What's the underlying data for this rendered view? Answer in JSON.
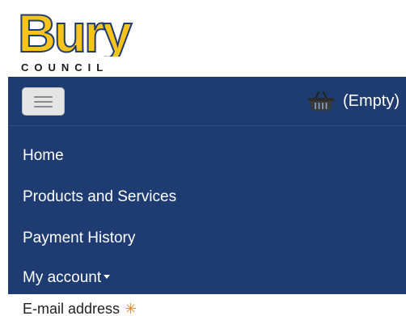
{
  "header": {
    "logo": {
      "brand_text": "Bury",
      "sub_text": "COUNCIL",
      "brand_color": "#f9c41a",
      "outline_color": "#1f3c72"
    }
  },
  "navbar": {
    "background": "#1f3c72",
    "menu_toggle_icon": "hamburger-icon",
    "basket": {
      "icon": "basket-icon",
      "label": "(Empty)"
    }
  },
  "menu": {
    "items": [
      {
        "label": "Home"
      },
      {
        "label": "Products and Services"
      },
      {
        "label": "Payment History"
      },
      {
        "label": "My account",
        "has_dropdown": true
      }
    ]
  },
  "form": {
    "email_label": "E-mail address",
    "required_marker": "✳",
    "required_color": "#f58220"
  }
}
